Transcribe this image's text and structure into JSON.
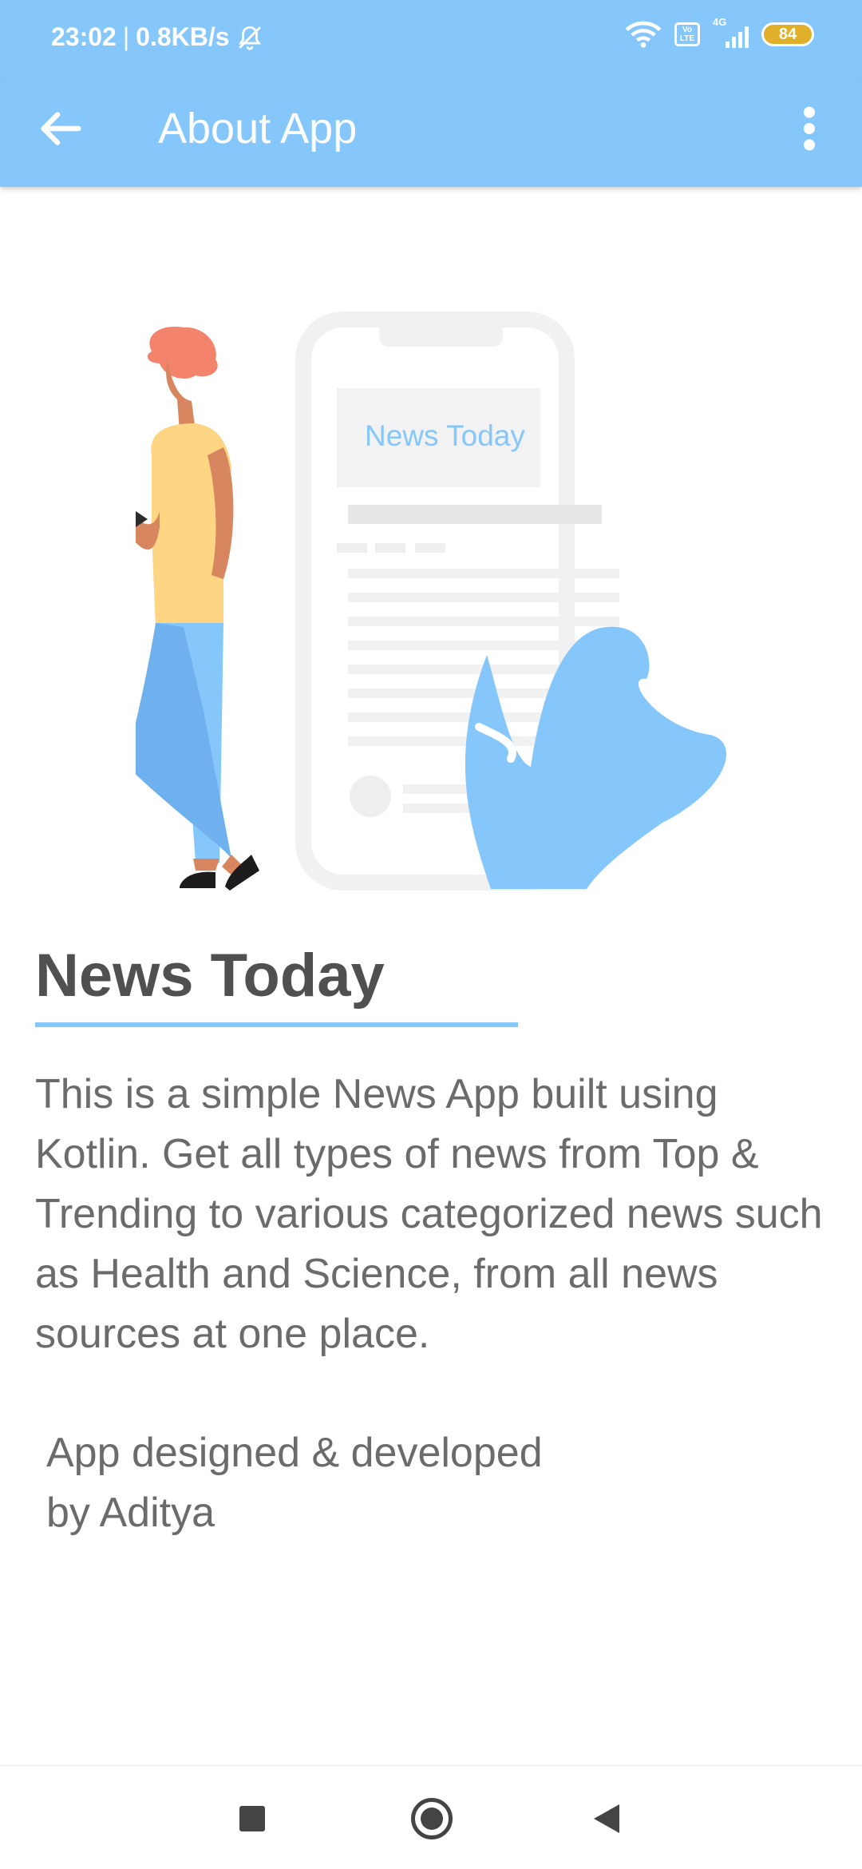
{
  "status": {
    "time": "23:02",
    "network_speed": "0.8KB/s",
    "volte": "Vo LTE",
    "signal_type": "4G",
    "battery": "84"
  },
  "appbar": {
    "title": "About App"
  },
  "illustration": {
    "phone_heading": "News Today"
  },
  "about": {
    "app_name": "News Today",
    "description": "This is a simple News App built using Kotlin. Get all types of news from Top & Trending to various categorized news such as Health and Science, from all news sources at one place.",
    "credits_line1": "App designed & developed",
    "credits_line2": "by Aditya"
  },
  "colors": {
    "accent": "#85c7fb",
    "text": "#6b6b6b",
    "title": "#505050"
  }
}
